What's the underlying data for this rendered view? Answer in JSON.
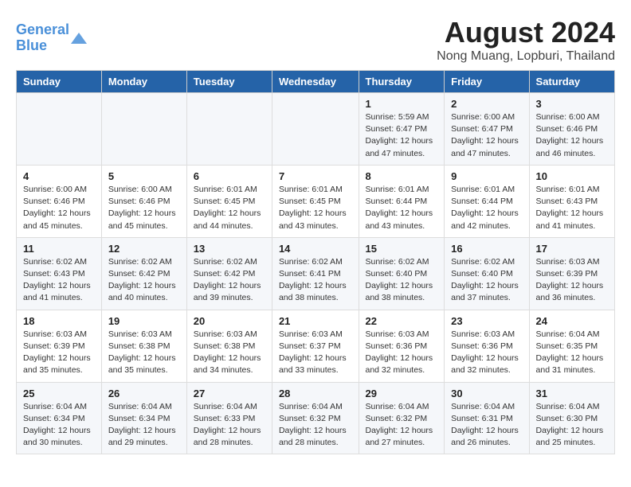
{
  "header": {
    "logo_general": "General",
    "logo_blue": "Blue",
    "title": "August 2024",
    "subtitle": "Nong Muang, Lopburi, Thailand"
  },
  "days_of_week": [
    "Sunday",
    "Monday",
    "Tuesday",
    "Wednesday",
    "Thursday",
    "Friday",
    "Saturday"
  ],
  "weeks": [
    [
      {
        "day": "",
        "info": ""
      },
      {
        "day": "",
        "info": ""
      },
      {
        "day": "",
        "info": ""
      },
      {
        "day": "",
        "info": ""
      },
      {
        "day": "1",
        "info": "Sunrise: 5:59 AM\nSunset: 6:47 PM\nDaylight: 12 hours\nand 47 minutes."
      },
      {
        "day": "2",
        "info": "Sunrise: 6:00 AM\nSunset: 6:47 PM\nDaylight: 12 hours\nand 47 minutes."
      },
      {
        "day": "3",
        "info": "Sunrise: 6:00 AM\nSunset: 6:46 PM\nDaylight: 12 hours\nand 46 minutes."
      }
    ],
    [
      {
        "day": "4",
        "info": "Sunrise: 6:00 AM\nSunset: 6:46 PM\nDaylight: 12 hours\nand 45 minutes."
      },
      {
        "day": "5",
        "info": "Sunrise: 6:00 AM\nSunset: 6:46 PM\nDaylight: 12 hours\nand 45 minutes."
      },
      {
        "day": "6",
        "info": "Sunrise: 6:01 AM\nSunset: 6:45 PM\nDaylight: 12 hours\nand 44 minutes."
      },
      {
        "day": "7",
        "info": "Sunrise: 6:01 AM\nSunset: 6:45 PM\nDaylight: 12 hours\nand 43 minutes."
      },
      {
        "day": "8",
        "info": "Sunrise: 6:01 AM\nSunset: 6:44 PM\nDaylight: 12 hours\nand 43 minutes."
      },
      {
        "day": "9",
        "info": "Sunrise: 6:01 AM\nSunset: 6:44 PM\nDaylight: 12 hours\nand 42 minutes."
      },
      {
        "day": "10",
        "info": "Sunrise: 6:01 AM\nSunset: 6:43 PM\nDaylight: 12 hours\nand 41 minutes."
      }
    ],
    [
      {
        "day": "11",
        "info": "Sunrise: 6:02 AM\nSunset: 6:43 PM\nDaylight: 12 hours\nand 41 minutes."
      },
      {
        "day": "12",
        "info": "Sunrise: 6:02 AM\nSunset: 6:42 PM\nDaylight: 12 hours\nand 40 minutes."
      },
      {
        "day": "13",
        "info": "Sunrise: 6:02 AM\nSunset: 6:42 PM\nDaylight: 12 hours\nand 39 minutes."
      },
      {
        "day": "14",
        "info": "Sunrise: 6:02 AM\nSunset: 6:41 PM\nDaylight: 12 hours\nand 38 minutes."
      },
      {
        "day": "15",
        "info": "Sunrise: 6:02 AM\nSunset: 6:40 PM\nDaylight: 12 hours\nand 38 minutes."
      },
      {
        "day": "16",
        "info": "Sunrise: 6:02 AM\nSunset: 6:40 PM\nDaylight: 12 hours\nand 37 minutes."
      },
      {
        "day": "17",
        "info": "Sunrise: 6:03 AM\nSunset: 6:39 PM\nDaylight: 12 hours\nand 36 minutes."
      }
    ],
    [
      {
        "day": "18",
        "info": "Sunrise: 6:03 AM\nSunset: 6:39 PM\nDaylight: 12 hours\nand 35 minutes."
      },
      {
        "day": "19",
        "info": "Sunrise: 6:03 AM\nSunset: 6:38 PM\nDaylight: 12 hours\nand 35 minutes."
      },
      {
        "day": "20",
        "info": "Sunrise: 6:03 AM\nSunset: 6:38 PM\nDaylight: 12 hours\nand 34 minutes."
      },
      {
        "day": "21",
        "info": "Sunrise: 6:03 AM\nSunset: 6:37 PM\nDaylight: 12 hours\nand 33 minutes."
      },
      {
        "day": "22",
        "info": "Sunrise: 6:03 AM\nSunset: 6:36 PM\nDaylight: 12 hours\nand 32 minutes."
      },
      {
        "day": "23",
        "info": "Sunrise: 6:03 AM\nSunset: 6:36 PM\nDaylight: 12 hours\nand 32 minutes."
      },
      {
        "day": "24",
        "info": "Sunrise: 6:04 AM\nSunset: 6:35 PM\nDaylight: 12 hours\nand 31 minutes."
      }
    ],
    [
      {
        "day": "25",
        "info": "Sunrise: 6:04 AM\nSunset: 6:34 PM\nDaylight: 12 hours\nand 30 minutes."
      },
      {
        "day": "26",
        "info": "Sunrise: 6:04 AM\nSunset: 6:34 PM\nDaylight: 12 hours\nand 29 minutes."
      },
      {
        "day": "27",
        "info": "Sunrise: 6:04 AM\nSunset: 6:33 PM\nDaylight: 12 hours\nand 28 minutes."
      },
      {
        "day": "28",
        "info": "Sunrise: 6:04 AM\nSunset: 6:32 PM\nDaylight: 12 hours\nand 28 minutes."
      },
      {
        "day": "29",
        "info": "Sunrise: 6:04 AM\nSunset: 6:32 PM\nDaylight: 12 hours\nand 27 minutes."
      },
      {
        "day": "30",
        "info": "Sunrise: 6:04 AM\nSunset: 6:31 PM\nDaylight: 12 hours\nand 26 minutes."
      },
      {
        "day": "31",
        "info": "Sunrise: 6:04 AM\nSunset: 6:30 PM\nDaylight: 12 hours\nand 25 minutes."
      }
    ]
  ]
}
